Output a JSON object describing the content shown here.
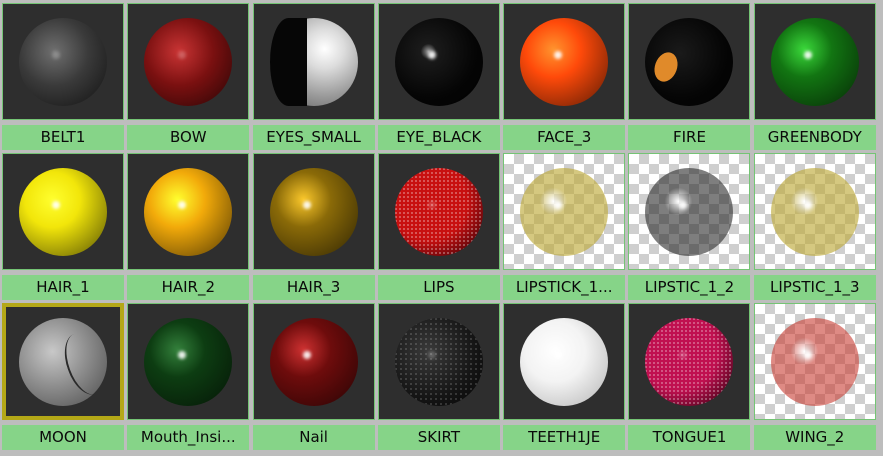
{
  "materials": [
    {
      "name": "BELT1",
      "color": "#3a3a3a",
      "style": "matte",
      "bg": "dark"
    },
    {
      "name": "BOW",
      "color": "#7a1010",
      "style": "matte",
      "bg": "dark"
    },
    {
      "name": "EYES_SMALL",
      "color": "#d8d8d8",
      "style": "eye",
      "bg": "dark"
    },
    {
      "name": "EYE_BLACK",
      "color": "#0a0a0a",
      "style": "black",
      "bg": "dark"
    },
    {
      "name": "FACE_3",
      "color": "#ff4a0a",
      "style": "glossy",
      "bg": "dark"
    },
    {
      "name": "FIRE",
      "color": "#050505",
      "style": "fire",
      "bg": "dark"
    },
    {
      "name": "GREENBODY",
      "color": "#127512",
      "style": "glossy",
      "bg": "dark"
    },
    {
      "name": "HAIR_1",
      "color": "#f2e60a",
      "style": "glossy",
      "bg": "dark"
    },
    {
      "name": "HAIR_2",
      "color": "#f2aa0a",
      "style": "glossy",
      "bg": "dark"
    },
    {
      "name": "HAIR_3",
      "color": "#8a6a08",
      "style": "glossy",
      "bg": "dark"
    },
    {
      "name": "LIPS",
      "color": "#c81010",
      "style": "speckle",
      "bg": "dark"
    },
    {
      "name": "LIPSTICK_1...",
      "color": "rgba(190,170,60,0.65)",
      "style": "transparent",
      "bg": "checker"
    },
    {
      "name": "LIPSTIC_1_2",
      "color": "rgba(40,40,40,0.6)",
      "style": "transparent",
      "bg": "checker"
    },
    {
      "name": "LIPSTIC_1_3",
      "color": "rgba(190,170,60,0.65)",
      "style": "transparent",
      "bg": "checker"
    },
    {
      "name": "MOON",
      "color": "#8a8a8a",
      "style": "moon",
      "bg": "dark",
      "selected": true
    },
    {
      "name": "Mouth_Insi...",
      "color": "#0d3d12",
      "style": "glossy",
      "bg": "dark"
    },
    {
      "name": "Nail",
      "color": "#6e0c0c",
      "style": "glossy",
      "bg": "dark"
    },
    {
      "name": "SKIRT",
      "color": "#1e1e1e",
      "style": "speckle-dark",
      "bg": "dark"
    },
    {
      "name": "TEETH1JE",
      "color": "#f0f0f0",
      "style": "white",
      "bg": "dark"
    },
    {
      "name": "TONGUE1",
      "color": "#c01050",
      "style": "speckle",
      "bg": "dark"
    },
    {
      "name": "WING_2",
      "color": "rgba(200,60,50,0.6)",
      "style": "transparent",
      "bg": "checker"
    }
  ]
}
